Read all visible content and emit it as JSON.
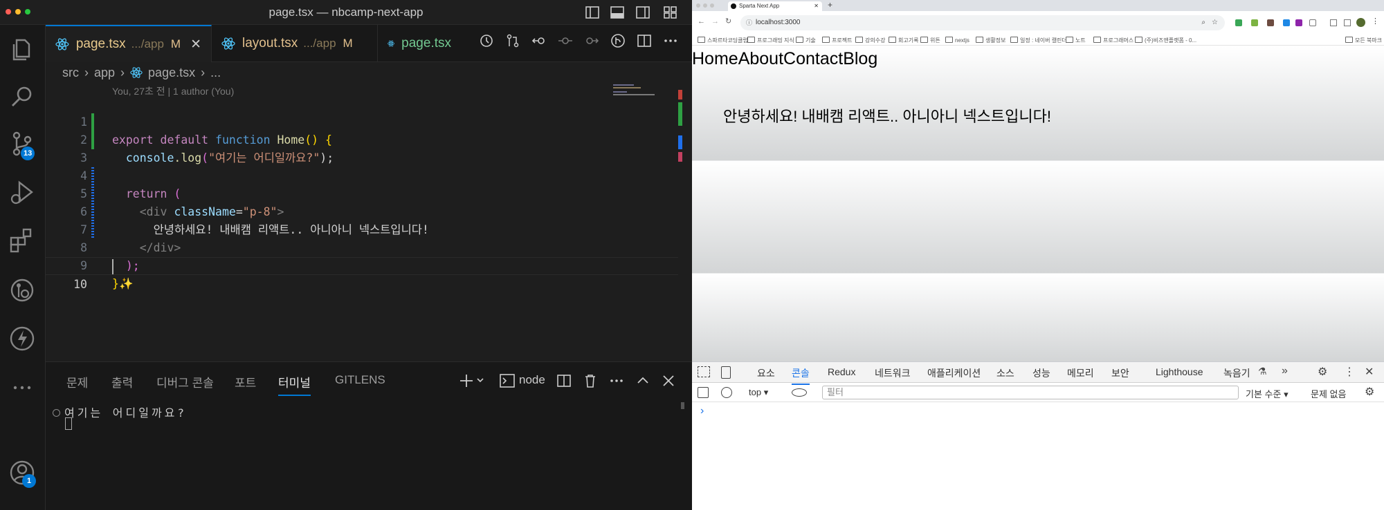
{
  "vscode": {
    "window_title": "page.tsx — nbcamp-next-app",
    "scm_badge": "13",
    "accounts_badge": "1",
    "tabs": [
      {
        "label": "page.tsx",
        "dir": ".../app",
        "status": "M",
        "close": "✕"
      },
      {
        "label": "layout.tsx",
        "dir": ".../app",
        "status": "M"
      },
      {
        "label": "page.tsx"
      }
    ],
    "breadcrumb": [
      "src",
      "app",
      "page.tsx",
      "..."
    ],
    "blame": "You, 27초 전 | 1 author (You)",
    "lines": [
      {
        "n": "1"
      },
      {
        "n": "2"
      },
      {
        "n": "3"
      },
      {
        "n": "4"
      },
      {
        "n": "5"
      },
      {
        "n": "6"
      },
      {
        "n": "7"
      },
      {
        "n": "8"
      },
      {
        "n": "9"
      },
      {
        "n": "10"
      }
    ],
    "code": {
      "l1_export": "export",
      "l1_default": "default",
      "l1_function": "function",
      "l1_name": "Home",
      "l1_paren": "()",
      "l1_brace": "{",
      "l2_obj": "console",
      "l2_method": ".log",
      "l2_open": "(",
      "l2_str": "\"여기는 어디일까요?\"",
      "l2_close": ");",
      "l4_return": "return",
      "l4_paren": "(",
      "l5_open": "<div",
      "l5_attr": "className",
      "l5_eq": "=",
      "l5_val": "\"p-8\"",
      "l5_gt": ">",
      "l6_text": "안녕하세요! 내배캠 리액트.. 아니아니 넥스트입니다!",
      "l7_close": "</div>",
      "l8_close": ");",
      "l9_brace": "}",
      "l9_sparkle": "✨"
    },
    "panel": {
      "tabs": [
        "문제",
        "출력",
        "디버그 콘솔",
        "포트",
        "터미널",
        "GITLENS"
      ],
      "active_tab": "터미널",
      "shell": "node",
      "output_line": "여기는 어디일까요?"
    }
  },
  "browser": {
    "tab_title": "Sparta Next App",
    "new_tab": "+",
    "url": "localhost:3000",
    "bookmarks": [
      "스파르타코딩클럽",
      "프로그래밍 지식",
      "기술",
      "프로젝트",
      "강의수강",
      "회고기록",
      "위튼",
      "nextjs",
      "생활정보",
      "일정 : 네이버 캘린더",
      "노트",
      "프로그래머스",
      "(주)비즈앤플랫폼 - 0..."
    ],
    "all_bookmarks": "모든 북마크",
    "nav_links": [
      "Home",
      "About",
      "Contact",
      "Blog"
    ],
    "greeting": "안녕하세요! 내배캠 리액트.. 아니아니 넥스트입니다!",
    "devtools": {
      "tabs": [
        "요소",
        "콘솔",
        "Redux",
        "네트워크",
        "애플리케이션",
        "소스",
        "성능",
        "메모리",
        "보안",
        "Lighthouse",
        "녹음기"
      ],
      "active_tab": "콘솔",
      "context": "top",
      "filter_placeholder": "필터",
      "level": "기본 수준",
      "issues": "문제 없음",
      "prompt": "›"
    }
  }
}
